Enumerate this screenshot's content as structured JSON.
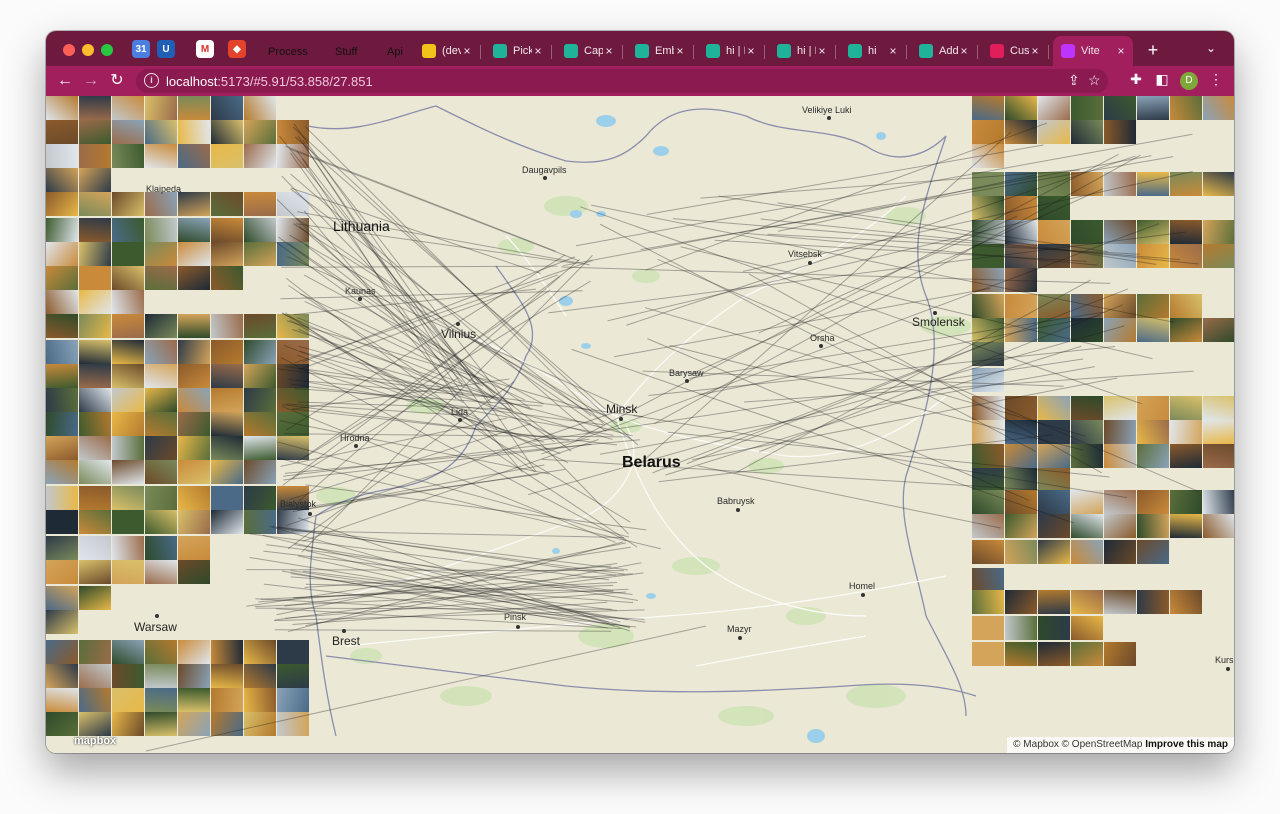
{
  "browser": {
    "pinned_tabs": [
      {
        "name": "calendar",
        "icon": "calendar-icon",
        "color": "#4a7fe0",
        "glyph": "31"
      },
      {
        "name": "bitwarden",
        "icon": "shield-icon",
        "color": "#1f5fb5",
        "glyph": "U"
      },
      {
        "name": "gmail",
        "icon": "mail-icon",
        "color": "#ffffff",
        "glyph": "M"
      },
      {
        "name": "gitlab",
        "icon": "fox-icon",
        "color": "#e2432a",
        "glyph": "◆"
      }
    ],
    "tab_groups": [
      {
        "label": "Process",
        "color": "#8ab4f8"
      },
      {
        "label": "Stuff",
        "color": "#81c995"
      },
      {
        "label": "Api",
        "color": "#dadce0"
      }
    ],
    "tabs": [
      {
        "title": "(dev",
        "icon": "star-icon",
        "color": "#f2c318",
        "active": false
      },
      {
        "title": "Pick",
        "icon": "hummingbird-icon",
        "color": "#1fb39a",
        "active": false
      },
      {
        "title": "Cap",
        "icon": "hummingbird-icon",
        "color": "#1fb39a",
        "active": false
      },
      {
        "title": "Emb",
        "icon": "hummingbird-icon",
        "color": "#1fb39a",
        "active": false
      },
      {
        "title": "hi | I",
        "icon": "hummingbird-icon",
        "color": "#1fb39a",
        "active": false
      },
      {
        "title": "hi | I",
        "icon": "hummingbird-icon",
        "color": "#1fb39a",
        "active": false
      },
      {
        "title": "hi",
        "icon": "hummingbird-icon",
        "color": "#1fb39a",
        "active": false
      },
      {
        "title": "Add",
        "icon": "hummingbird-icon",
        "color": "#1fb39a",
        "active": false
      },
      {
        "title": "Cus",
        "icon": "slack-icon",
        "color": "#e01e5a",
        "active": false
      },
      {
        "title": "Vite",
        "icon": "vite-icon",
        "color": "#bd34fe",
        "active": true
      }
    ],
    "new_tab": "+",
    "url_host": "localhost",
    "url_path": ":5173/#5.91/53.858/27.851",
    "profile_initial": "D"
  },
  "map": {
    "countries": [
      {
        "name": "Lithuania",
        "style": "country"
      },
      {
        "name": "Belarus",
        "style": "country-big"
      }
    ],
    "cities": [
      {
        "name": "Velikiye Luki",
        "size": "small"
      },
      {
        "name": "Daugavpils",
        "size": "small"
      },
      {
        "name": "Klaipeda",
        "size": "small"
      },
      {
        "name": "Vitsebsk",
        "size": "small"
      },
      {
        "name": "Kaunas",
        "size": "small"
      },
      {
        "name": "Vilnius",
        "size": "city"
      },
      {
        "name": "Smolensk",
        "size": "city"
      },
      {
        "name": "Orsha",
        "size": "small"
      },
      {
        "name": "Barysaw",
        "size": "small"
      },
      {
        "name": "Lida",
        "size": "small"
      },
      {
        "name": "Minsk",
        "size": "city"
      },
      {
        "name": "Hrodna",
        "size": "small"
      },
      {
        "name": "Babruysk",
        "size": "small"
      },
      {
        "name": "Bialystok",
        "size": "small"
      },
      {
        "name": "Homel",
        "size": "small"
      },
      {
        "name": "Warsaw",
        "size": "city"
      },
      {
        "name": "Brest",
        "size": "city"
      },
      {
        "name": "Pinsk",
        "size": "small"
      },
      {
        "name": "Mazyr",
        "size": "small"
      },
      {
        "name": "Kursk",
        "size": "small"
      }
    ],
    "attribution": "© Mapbox © OpenStreetMap",
    "improve_link": "Improve this map",
    "logo": "mapbox"
  },
  "colors": {
    "tabbar": "#6e1a3f",
    "toolbar": "#a01f5c",
    "map_land": "#ebe8d6",
    "lines": "#1a1a1a"
  }
}
